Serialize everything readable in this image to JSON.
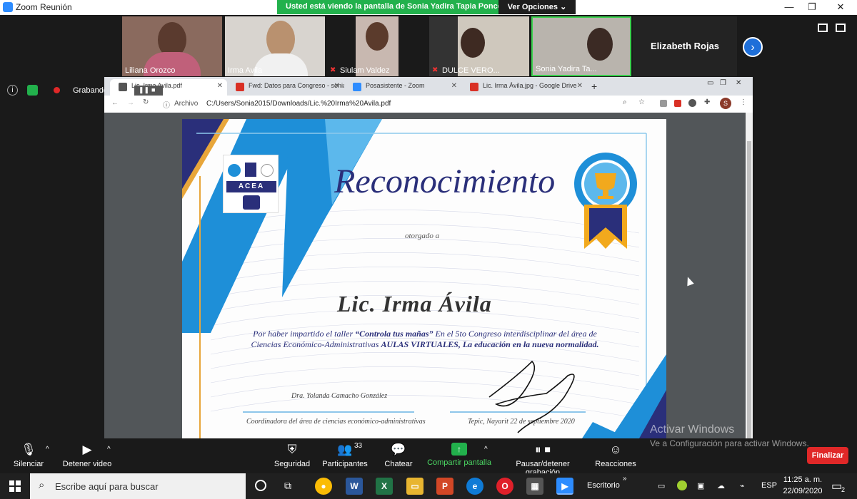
{
  "window": {
    "title": "Zoom Reunión",
    "minimize": "—",
    "maximize": "❐",
    "close": "✕"
  },
  "share_banner": {
    "text": "Usted está viendo la pantalla de Sonia Yadira Tapia Ponce",
    "options": "Ver Opciones ⌄"
  },
  "participants": [
    {
      "name": "Liliana Orozco"
    },
    {
      "name": "Irma Avila"
    },
    {
      "name": "Siulam Valdez"
    },
    {
      "name": "DULCE VERO..."
    },
    {
      "name": "Sonia Yadira Ta..."
    }
  ],
  "featured_participant": "Elizabeth Rojas",
  "recording": {
    "label": "Grabando..."
  },
  "browser": {
    "tabs": [
      {
        "label": "Lic. Irma Avila.pdf",
        "color": "#555555"
      },
      {
        "label": "Fwd: Datos para Congreso - sonia",
        "color": "#d93025"
      },
      {
        "label": "Posasistente - Zoom",
        "color": "#2d8cff"
      },
      {
        "label": "Lic. Irma Ávila.jpg - Google Drive",
        "color": "#d93025"
      }
    ],
    "new_tab": "+",
    "address_prefix": "Archivo",
    "address": "C:/Users/Sonia2015/Downloads/Lic.%20Irma%20Avila.pdf",
    "profile_initial": "S"
  },
  "certificate": {
    "logo_text": "ACEA",
    "title": "Reconocimiento",
    "granted_to": "otorgado a",
    "recipient": "Lic. Irma Ávila",
    "body_line1_a": "Por haber impartido el taller ",
    "body_line1_workshop": "“Controla tus mañas”",
    "body_line1_b": " En el 5to Congreso interdisciplinar del área de",
    "body_line2_a": "Ciencias Económico-Administrativas ",
    "body_line2_b": "AULAS VIRTUALES, La educación en la nueva normalidad.",
    "signer_name": "Dra. Yolanda Camacho González",
    "signer_role": "Coordinadora del área de ciencias económico-administrativas",
    "place_date": "Tepic, Nayarit 22 de septiembre 2020"
  },
  "toolbar": {
    "mute": "Silenciar",
    "video": "Detener video",
    "security": "Seguridad",
    "participants": "Participantes",
    "participants_count": "33",
    "chat": "Chatear",
    "share": "Compartir pantalla",
    "pause_rec": "Pausar/detener grabación",
    "reactions": "Reacciones",
    "end": "Finalizar"
  },
  "activation": {
    "line1": "Activar Windows",
    "line2": "Ve a Configuración para activar Windows."
  },
  "taskbar": {
    "search_placeholder": "Escribe aquí para buscar",
    "desktop": "Escritorio",
    "lang": "ESP",
    "time": "11:25 a. m.",
    "date": "22/09/2020",
    "notif_count": "2"
  },
  "colors": {
    "zoom_green": "#22b14c",
    "zoom_blue": "#2d8cff",
    "end_red": "#e02828",
    "cert_navy": "#2a2f7a",
    "cert_blue": "#1e8fd8"
  }
}
